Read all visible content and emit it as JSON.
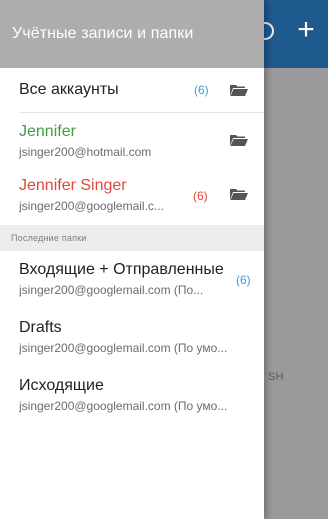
{
  "app": {
    "snippet": "SH",
    "plus_glyph": "+"
  },
  "drawer": {
    "title": "Учётные записи и папки",
    "all_accounts": {
      "label": "Все аккаунты",
      "count": "(6)"
    },
    "accounts": [
      {
        "name": "Jennifer",
        "email": "jsinger200@hotmail.com",
        "count": ""
      },
      {
        "name": "Jennifer Singer",
        "email": "jsinger200@googlemail.c...",
        "count": "(6)"
      }
    ],
    "recent_folders_header": "Последние папки",
    "recent_folders": [
      {
        "name": "Входящие + Отправленные",
        "account": "jsinger200@googlemail.com (По...",
        "count": "(6)"
      },
      {
        "name": "Drafts",
        "account": "jsinger200@googlemail.com (По умо...",
        "count": ""
      },
      {
        "name": "Исходящие",
        "account": "jsinger200@googlemail.com (По умо...",
        "count": ""
      }
    ]
  },
  "colors": {
    "app_header": "#1f5a8f",
    "drawer_header": "#adadad",
    "account_green": "#3f9e45",
    "account_red": "#e1463a",
    "count_blue": "#3aa0d8"
  },
  "icons": {
    "folder": "folder-icon",
    "search": "search-icon",
    "add": "plus-icon"
  }
}
